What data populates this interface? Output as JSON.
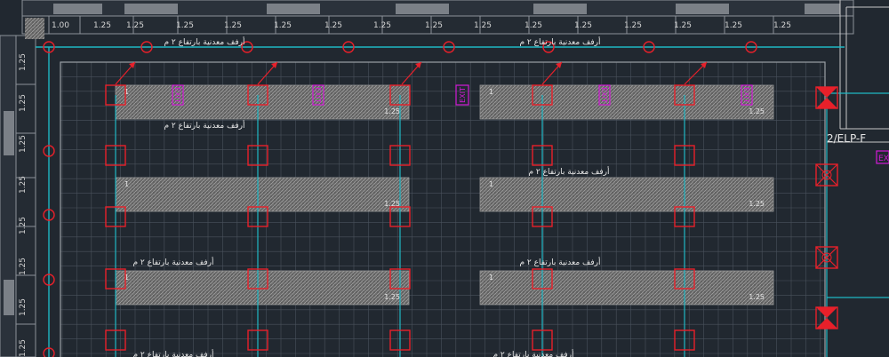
{
  "colors": {
    "background": "#212830",
    "grid": "#4a525c",
    "cyan": "#1fb7c4",
    "red": "#e8202a",
    "magenta": "#d21ad6",
    "white": "#e6e6e6",
    "hatch": "#8a8a8a"
  },
  "ruler_top": [
    "1.00",
    "1.25",
    "1.25",
    "1.25",
    "1.25",
    "1.25",
    "1.25",
    "1.25",
    "1.25",
    "1.25",
    "1.25",
    "1.25",
    "1.25",
    "1.25",
    "1.25",
    "1.25"
  ],
  "ruler_left": [
    "1.25",
    "1.25",
    "1.25",
    "1.25",
    "1.25",
    "1.25",
    "1.25",
    "1.25"
  ],
  "shelf_label": "أرفف معدنية بارتفاع ٢ م",
  "exit_label": "EXIT",
  "exit_partial_label": "EX",
  "panel_label": "2/ELP-F",
  "dim_one": "1",
  "dim_one_25": "1.25",
  "icons": [
    "exit-sign-icon",
    "emergency-light-icon",
    "fixture-icon",
    "leader-arrow-icon",
    "column-marker-icon"
  ]
}
